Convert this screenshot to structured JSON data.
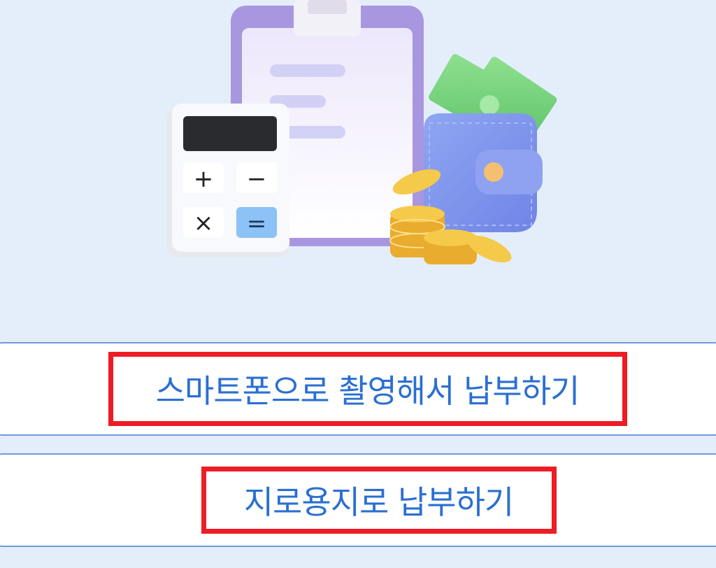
{
  "illustration": {
    "icon": "payment-illustration",
    "calculator_keys": {
      "plus": "+",
      "minus": "−",
      "times": "×",
      "equals": "="
    },
    "colors": {
      "background": "#e4eefb",
      "clipboard": "#a996e0",
      "wallet": "#7f96ec",
      "cash": "#7fd77f",
      "coin": "#f5c94a",
      "equals_key": "#8cc2f5"
    }
  },
  "buttons": {
    "camera_label": "스마트폰으로 촬영해서 납부하기",
    "giro_label": "지로용지로 납부하기",
    "text_color": "#2b6fd1",
    "border_color": "#6f9ad8",
    "highlight_color": "#ee1c24"
  }
}
